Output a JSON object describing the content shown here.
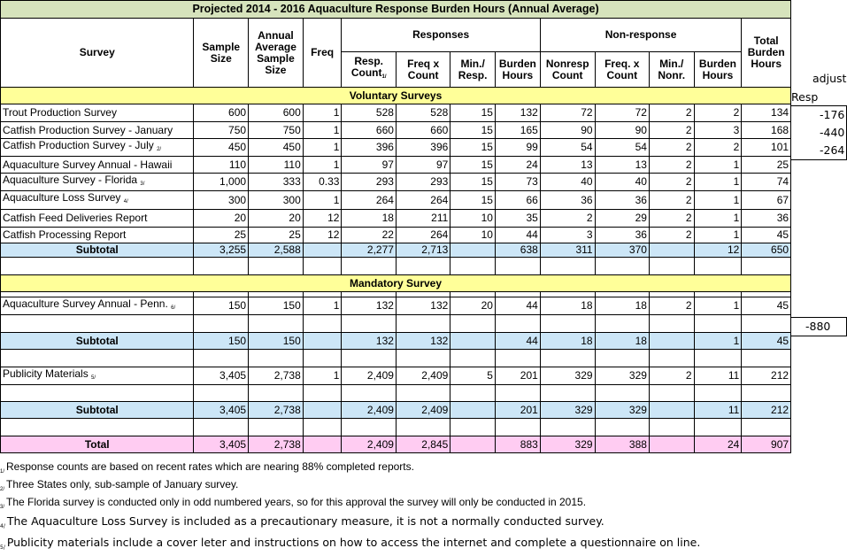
{
  "title": "Projected 2014 - 2016 Aquaculture Response Burden Hours (Annual Average)",
  "headers": {
    "survey": "Survey",
    "sample_size": "Sample Size",
    "annual_avg": "Annual Average Sample Size",
    "freq": "Freq",
    "responses": "Responses",
    "nonresponse": "Non-response",
    "total_burden": "Total Burden Hours",
    "resp_count": "Resp. Count",
    "freq_x_count": "Freq x Count",
    "min_resp": "Min./ Resp.",
    "burden_hours": "Burden Hours",
    "nonresp_count": "Nonresp Count",
    "freq_x_count2": "Freq. x Count",
    "min_nonr": "Min./ Nonr.",
    "burden_hours2": "Burden Hours"
  },
  "side": {
    "adjust": "adjust",
    "resp": "Resp",
    "vals": [
      "-176",
      "-440",
      "-264"
    ],
    "mand_val": "-880"
  },
  "sections": {
    "voluntary": "Voluntary Surveys",
    "mandatory": "Mandatory Survey"
  },
  "voluntary_rows": [
    {
      "name": "Trout Production Survey",
      "fn": "",
      "v": [
        "600",
        "600",
        "1",
        "528",
        "528",
        "15",
        "132",
        "72",
        "72",
        "2",
        "2",
        "134"
      ]
    },
    {
      "name": "Catfish Production Survey - January",
      "fn": "",
      "v": [
        "750",
        "750",
        "1",
        "660",
        "660",
        "15",
        "165",
        "90",
        "90",
        "2",
        "3",
        "168"
      ]
    },
    {
      "name": "Catfish Production Survey - July",
      "fn": "2/",
      "v": [
        "450",
        "450",
        "1",
        "396",
        "396",
        "15",
        "99",
        "54",
        "54",
        "2",
        "2",
        "101"
      ]
    },
    {
      "name": "Aquaculture Survey Annual - Hawaii",
      "fn": "",
      "v": [
        "110",
        "110",
        "1",
        "97",
        "97",
        "15",
        "24",
        "13",
        "13",
        "2",
        "1",
        "25"
      ]
    },
    {
      "name": "Aquaculture Survey - Florida",
      "fn": "3/",
      "v": [
        "1,000",
        "333",
        "0.33",
        "293",
        "293",
        "15",
        "73",
        "40",
        "40",
        "2",
        "1",
        "74"
      ]
    },
    {
      "name": "Aquaculture Loss Survey",
      "fn": "4/",
      "v": [
        "300",
        "300",
        "1",
        "264",
        "264",
        "15",
        "66",
        "36",
        "36",
        "2",
        "1",
        "67"
      ]
    },
    {
      "name": "Catfish Feed Deliveries Report",
      "fn": "",
      "v": [
        "20",
        "20",
        "12",
        "18",
        "211",
        "10",
        "35",
        "2",
        "29",
        "2",
        "1",
        "36"
      ]
    },
    {
      "name": "Catfish Processing Report",
      "fn": "",
      "v": [
        "25",
        "25",
        "12",
        "22",
        "264",
        "10",
        "44",
        "3",
        "36",
        "2",
        "1",
        "45"
      ]
    }
  ],
  "subtotal_label": "Subtotal",
  "total_label": "Total",
  "vol_subtotal": [
    "3,255",
    "2,588",
    "",
    "2,277",
    "2,713",
    "",
    "638",
    "311",
    "370",
    "",
    "12",
    "650"
  ],
  "mand_row": {
    "name": "Aquaculture Survey Annual - Penn.",
    "fn": "6/",
    "v": [
      "150",
      "150",
      "1",
      "132",
      "132",
      "20",
      "44",
      "18",
      "18",
      "2",
      "1",
      "45"
    ]
  },
  "mand_subtotal": [
    "150",
    "150",
    "",
    "132",
    "132",
    "",
    "44",
    "18",
    "18",
    "",
    "1",
    "45"
  ],
  "pub_row": {
    "name": "Publicity Materials",
    "fn": "5/",
    "v": [
      "3,405",
      "2,738",
      "1",
      "2,409",
      "2,409",
      "5",
      "201",
      "329",
      "329",
      "2",
      "11",
      "212"
    ]
  },
  "pub_subtotal": [
    "3,405",
    "2,738",
    "",
    "2,409",
    "2,409",
    "",
    "201",
    "329",
    "329",
    "",
    "11",
    "212"
  ],
  "total": [
    "3,405",
    "2,738",
    "",
    "2,409",
    "2,845",
    "",
    "883",
    "329",
    "388",
    "",
    "24",
    "907"
  ],
  "notes": [
    {
      "mark": "1/",
      "text": "Response counts are based on recent rates which are nearing 88% completed reports."
    },
    {
      "mark": "2/",
      "text": "Three States only, sub-sample of January survey."
    },
    {
      "mark": "3/",
      "text": "The Florida survey is conducted only in odd numbered years, so for this approval the survey will only be conducted in 2015."
    },
    {
      "mark": "4/",
      "text": "The Aquaculture Loss Survey is included as a precautionary measure, it is not a normally conducted survey."
    },
    {
      "mark": "5/",
      "text": "Publicity materials include a cover leter and instructions on how to access the internet and complete a questionnaire on line."
    }
  ]
}
